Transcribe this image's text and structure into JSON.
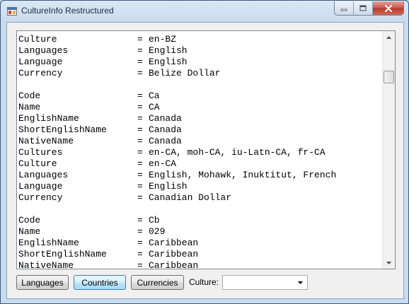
{
  "window": {
    "title": "CultureInfo Restructured"
  },
  "output": {
    "lines": [
      {
        "key": "Culture",
        "value": "en-BZ"
      },
      {
        "key": "Languages",
        "value": "English"
      },
      {
        "key": "Language",
        "value": "English"
      },
      {
        "key": "Currency",
        "value": "Belize Dollar"
      },
      {
        "key": "",
        "value": ""
      },
      {
        "key": "Code",
        "value": "Ca"
      },
      {
        "key": "Name",
        "value": "CA"
      },
      {
        "key": "EnglishName",
        "value": "Canada"
      },
      {
        "key": "ShortEnglishName",
        "value": "Canada"
      },
      {
        "key": "NativeName",
        "value": "Canada"
      },
      {
        "key": "Cultures",
        "value": "en-CA, moh-CA, iu-Latn-CA, fr-CA"
      },
      {
        "key": "Culture",
        "value": "en-CA"
      },
      {
        "key": "Languages",
        "value": "English, Mohawk, Inuktitut, French"
      },
      {
        "key": "Language",
        "value": "English"
      },
      {
        "key": "Currency",
        "value": "Canadian Dollar"
      },
      {
        "key": "",
        "value": ""
      },
      {
        "key": "Code",
        "value": "Cb"
      },
      {
        "key": "Name",
        "value": "029"
      },
      {
        "key": "EnglishName",
        "value": "Caribbean"
      },
      {
        "key": "ShortEnglishName",
        "value": "Caribbean"
      },
      {
        "key": "NativeName",
        "value": "Caribbean"
      }
    ],
    "separator": "="
  },
  "buttons": {
    "languages": "Languages",
    "countries": "Countries",
    "currencies": "Currencies"
  },
  "culture": {
    "label": "Culture:",
    "selected": ""
  },
  "icons": {
    "app": "app-window-icon",
    "minimize": "minimize-icon",
    "maximize": "maximize-icon",
    "close": "close-icon"
  },
  "colors": {
    "close_button": "#c75050",
    "focused_button": "#3c7fb1"
  }
}
